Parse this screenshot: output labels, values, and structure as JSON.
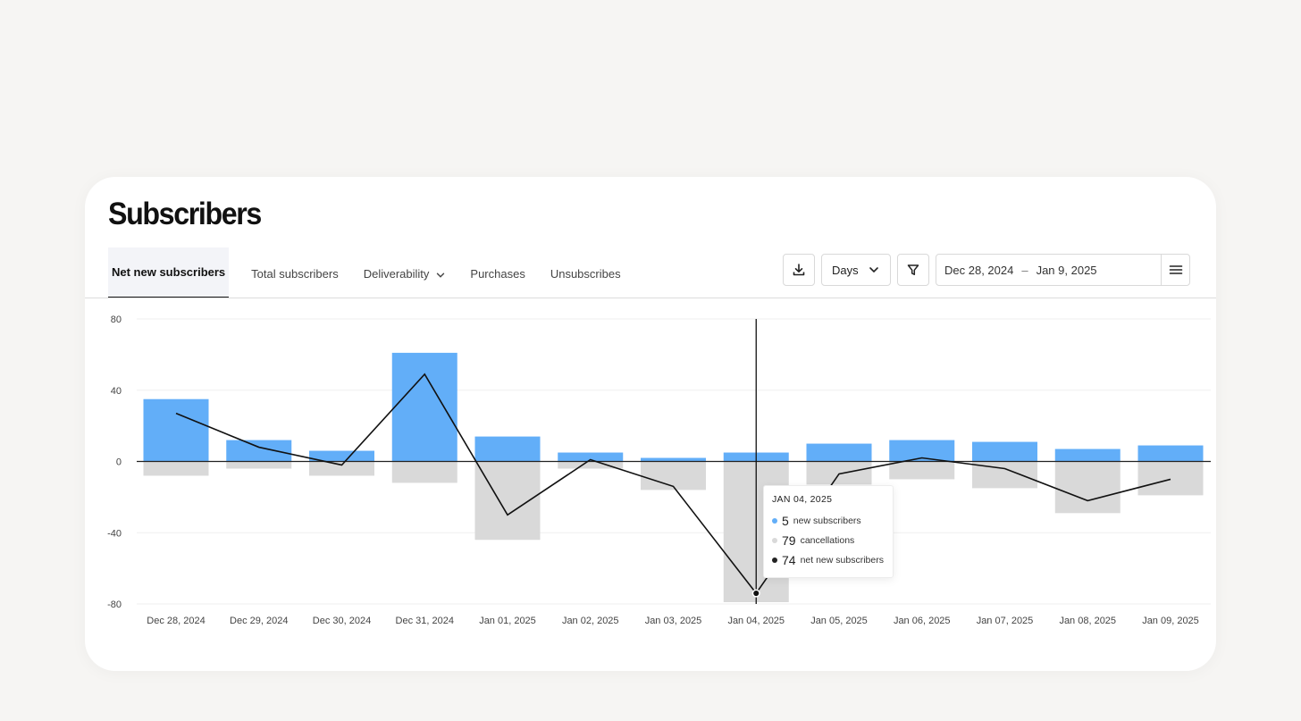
{
  "page": {
    "title": "Subscribers"
  },
  "tabs": [
    {
      "label": "Net new subscribers"
    },
    {
      "label": "Total subscribers"
    },
    {
      "label": "Deliverability"
    },
    {
      "label": "Purchases"
    },
    {
      "label": "Unsubscribes"
    }
  ],
  "controls": {
    "granularity": "Days",
    "date_start": "Dec 28, 2024",
    "date_separator": "–",
    "date_end": "Jan 9, 2025",
    "icons": [
      "download-icon",
      "chevron-down-icon",
      "filter-icon",
      "menu-icon"
    ]
  },
  "tooltip": {
    "date": "JAN 04, 2025",
    "rows": [
      {
        "value": "5",
        "label": "new subscribers",
        "color": "#62aef8"
      },
      {
        "value": "79",
        "label": "cancellations",
        "color": "#d9d9d9"
      },
      {
        "value": "74",
        "label": "net new subscribers",
        "color": "#222222"
      }
    ]
  },
  "colors": {
    "new": "#62aef8",
    "cancel": "#d9d9d9",
    "net_line": "#111111"
  },
  "chart_data": {
    "type": "bar",
    "categories": [
      "Dec 28, 2024",
      "Dec 29, 2024",
      "Dec 30, 2024",
      "Dec 31, 2024",
      "Jan 01, 2025",
      "Jan 02, 2025",
      "Jan 03, 2025",
      "Jan 04, 2025",
      "Jan 05, 2025",
      "Jan 06, 2025",
      "Jan 07, 2025",
      "Jan 08, 2025",
      "Jan 09, 2025"
    ],
    "series": [
      {
        "name": "new subscribers",
        "values": [
          35,
          12,
          6,
          61,
          14,
          5,
          2,
          5,
          10,
          12,
          11,
          7,
          9
        ]
      },
      {
        "name": "cancellations",
        "values": [
          -8,
          -4,
          -8,
          -12,
          -44,
          -4,
          -16,
          -79,
          -13,
          -10,
          -15,
          -29,
          -19
        ]
      },
      {
        "name": "net new subscribers",
        "values": [
          27,
          8,
          -2,
          49,
          -30,
          1,
          -14,
          -74,
          -7,
          2,
          -4,
          -22,
          -10
        ]
      }
    ],
    "yticks": [
      80,
      40,
      0,
      -40,
      -80
    ],
    "ylim": [
      -80,
      80
    ],
    "highlight_index": 7
  }
}
